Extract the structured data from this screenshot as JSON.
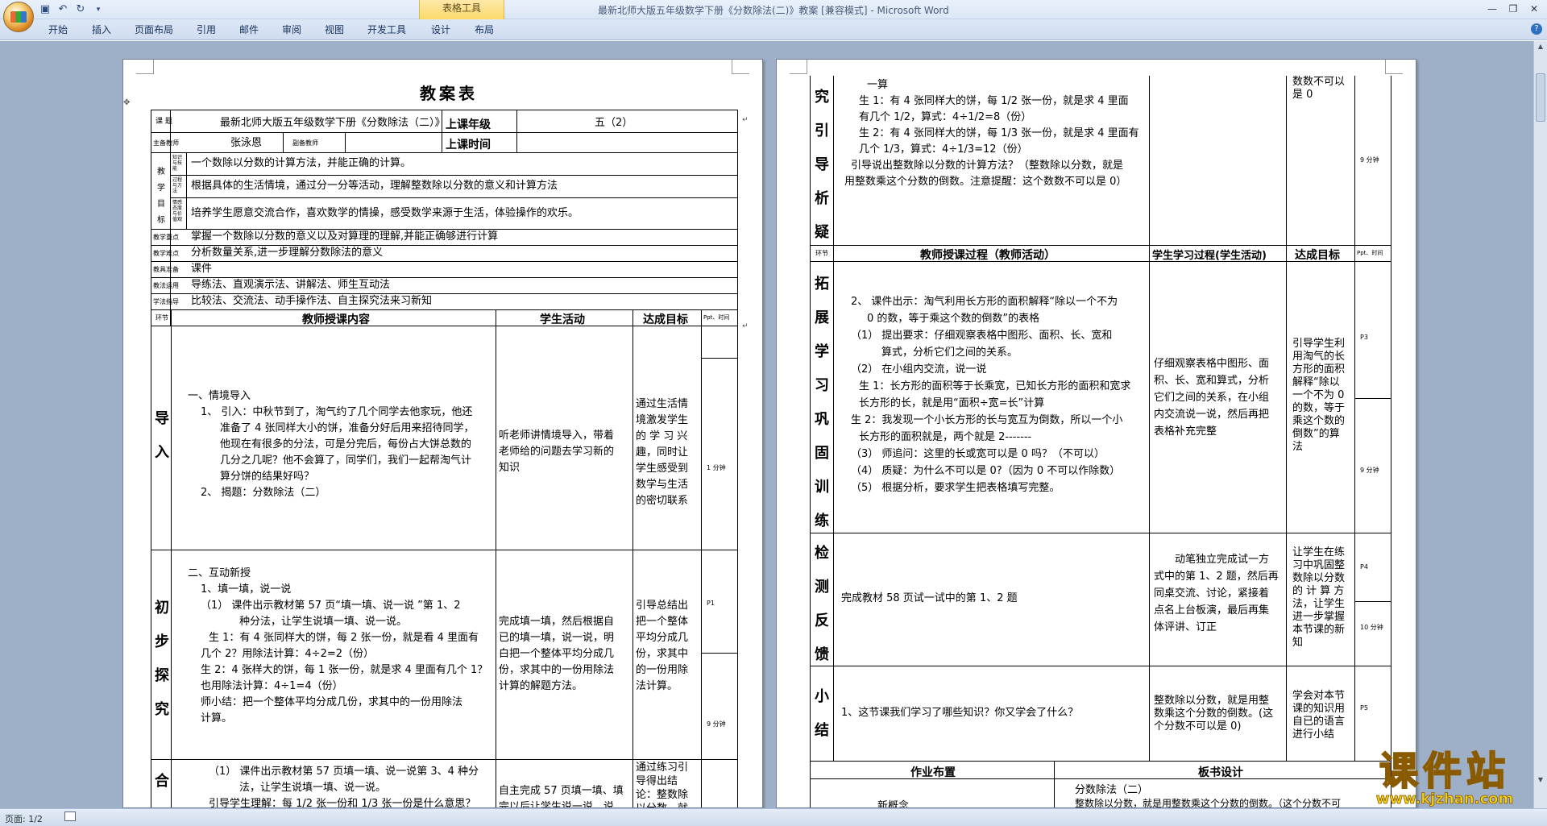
{
  "app": {
    "window_title": "最新北师大版五年级数学下册《分数除法(二)》教案 [兼容模式] - Microsoft Word",
    "context_tab_group": "表格工具",
    "tabs": [
      "开始",
      "插入",
      "页面布局",
      "引用",
      "邮件",
      "审阅",
      "视图",
      "开发工具",
      "设计",
      "布局"
    ],
    "status_page": "页面: 1/2",
    "icons": {
      "save": "save-icon",
      "undo": "undo-icon",
      "redo": "redo-icon",
      "help": "help-icon"
    }
  },
  "page1": {
    "title": "教案表",
    "row_topic": {
      "label": "课 题",
      "value": "最新北师大版五年级数学下册《分数除法（二）》",
      "grade_label": "上课年级",
      "grade_value": "五（2）"
    },
    "row_teacher": {
      "main_label": "主备教师",
      "main_value": "张泳恩",
      "assist_label": "副备教师",
      "time_label": "上课时间"
    },
    "goals": {
      "label": [
        "教",
        "学",
        "目",
        "标"
      ],
      "sub": [
        "知识与技能",
        "过程与方法",
        "情感态度与价值观"
      ],
      "items": [
        "一个数除以分数的计算方法，并能正确的计算。",
        "根据具体的生活情境，通过分一分等活动，理解整数除以分数的意义和计算方法",
        "培养学生愿意交流合作，喜欢数学的情操，感受数学来源于生活，体验操作的欢乐。"
      ]
    },
    "rows": [
      {
        "label": "教学重点",
        "value": "掌握一个数除以分数的意义以及对算理的理解,并能正确够进行计算"
      },
      {
        "label": "教学难点",
        "value": "分析数量关系,进一步理解分数除法的意义"
      },
      {
        "label": "教具准备",
        "value": "课件"
      },
      {
        "label": "教法运用",
        "value": "导练法、直观演示法、讲解法、师生互动法"
      },
      {
        "label": "学法指导",
        "value": "比较法、交流法、动手操作法、自主探究法来习新知"
      }
    ],
    "header": {
      "col0": "环节",
      "col1": "教师授课内容",
      "col2": "学生活动",
      "col3": "达成目标",
      "col4": "Ppt、时间"
    },
    "section_intro": {
      "name": [
        "导",
        "入"
      ],
      "content": [
        "一、情境导入",
        "1、 引入：中秋节到了，淘气约了几个同学去他家玩，他还",
        "准备了 4 张同样大小的饼，准备分好后用来招待同学，",
        "他现在有很多的分法，可是分完后，每份占大饼总数的",
        "几分之几呢？他不会算了，同学们，我们一起帮淘气计",
        "算分饼的结果好吗？",
        "2、 揭题：分数除法（二）"
      ],
      "student": [
        "听老师讲情境导入，带着",
        "老师给的问题去学习新的",
        "知识"
      ],
      "goal": [
        "通过生活情",
        "境激发学生",
        "的 学 习 兴",
        "趣，同时让",
        "学生感受到",
        "数学与生活",
        "的密切联系"
      ],
      "time": "1 分钟"
    },
    "section_explore": {
      "name": [
        "初",
        "步",
        "探",
        "究"
      ],
      "content": [
        "二、互动新授",
        "1、填一填，说一说",
        "（1）    课件出示教材第 57 页“填一填、说一说 ”第 1、2",
        "种分法，让学生说填一填、说一说。",
        "生 1：有 4 张同样大的饼，每 2 张一份，就是看 4 里面有",
        "几个 2？用除法计算：4÷2=2（份）",
        "生 2：4 张样大的饼，每 1 张一份，就是求 4 里面有几个 1？",
        "也用除法计算：4÷1=4（份）",
        "师小结：把一个整体平均分成几份，求其中的一份用除法",
        "计算。"
      ],
      "student": [
        "完成填一填，然后根据自",
        "已的填一填，说一说，明",
        "白把一个整体平均分成几",
        "份，求其中的一份用除法",
        "计算的解题方法。"
      ],
      "goal": [
        "引导总结出",
        "把一个整体",
        "平均分成几",
        "份，求其中",
        "的一份用除",
        "法计算。"
      ],
      "ppt": "P1",
      "time": "9 分钟"
    },
    "section_combine": {
      "name": [
        "合"
      ],
      "content": [
        "（1）    课件出示教材第 57 页填一填、说一说第 3、4 种分",
        "法，让学生说填一填、说一说。",
        "引导学生理解：每 1/2 张一份和 1/3 张一份是什么意思？"
      ],
      "student": [
        "自主完成 57 页填一填、填",
        "完以后让学生说一说，说"
      ],
      "goal": [
        "通过练习引",
        "导得出结",
        "论：整数除",
        "以分数，就"
      ]
    }
  },
  "page2": {
    "section_research": {
      "name": [
        "究",
        "引",
        "导",
        "析",
        "疑"
      ],
      "content": [
        "一算",
        "生 1：有 4 张同样大的饼，每 1/2 张一份，就是求 4 里面",
        "有几个 1/2，算式：4÷1/2=8（份）",
        "生 2：有 4 张同样大的饼，每 1/3 张一份，就是求 4 里面有",
        "几个 1/3，算式：4÷1/3=12（份）",
        "引导说出整数除以分数的计算方法？（整数除以分数，就是",
        "用整数乘这个分数的倒数。注意提醒：这个数数不可以是 0）"
      ],
      "goal": [
        "数数不可以",
        "是 0"
      ],
      "time": "9 分钟"
    },
    "header": {
      "col0": "环节",
      "col1": "教师授课过程（教师活动）",
      "col2": "学生学习过程(学生活动)",
      "col3": "达成目标",
      "col4": "Ppt、时间"
    },
    "section_expand": {
      "name": [
        "拓",
        "展",
        "学",
        "习",
        "巩",
        "固",
        "训",
        "练"
      ],
      "content": [
        "2、 课件出示：淘气利用长方形的面积解释“除以一个不为",
        "0 的数，等于乘这个数的倒数”的表格",
        "（1）    提出要求：仔细观察表格中图形、面积、长、宽和",
        "算式，分析它们之间的关系。",
        "（2）    在小组内交流，说一说",
        "生 1：长方形的面积等于长乘宽，已知长方形的面积和宽求",
        "长方形的长，就是用“面积÷宽=长”计算",
        "生 2：我发现一个小长方形的长与宽互为倒数，所以一个小",
        "长方形的面积就是，两个就是 2-------",
        "（3）    师追问：这里的长或宽可以是 0 吗？（不可以）",
        "（4）    质疑：为什么不可以是 0?（因为 0 不可以作除数）",
        "（5）    根据分析，要求学生把表格填写完整。"
      ],
      "student": [
        "仔细观察表格中图形、面",
        "积、长、宽和算式，分析",
        "它们之间的关系，在小组",
        "内交流说一说，然后再把",
        "表格补充完整"
      ],
      "goal": [
        "引导学生利",
        "用淘气的长",
        "方形的面积",
        "解释“除以",
        "一个不为 0",
        "的数，等于",
        "乘这个数的",
        "倒数”的算",
        "法"
      ],
      "ppt": "P3",
      "time": "9 分钟"
    },
    "section_check": {
      "name": [
        "检",
        "测",
        "反",
        "馈"
      ],
      "content": "完成教材 58 页试一试中的第 1、2 题",
      "student": [
        "动笔独立完成试一方",
        "式中的第 1、2 题，然后再",
        "同桌交流、讨论，紧接着",
        "点名上台板演，最后再集",
        "体评讲、订正"
      ],
      "goal": [
        "让学生在练",
        "习中巩固整",
        "数除以分数",
        "的 计 算 方",
        "法，让学生",
        "进一步掌握",
        "本节课的新",
        "知"
      ],
      "ppt": "P4",
      "time": "10 分钟"
    },
    "section_summary": {
      "name": [
        "小",
        "结"
      ],
      "content": "1、这节课我们学习了哪些知识？你又学会了什么？",
      "student": [
        "整数除以分数，就是用整",
        "数乘这个分数的倒数。(这",
        "个分数不可以是 0)"
      ],
      "goal": [
        "学会对本节",
        "课的知识用",
        "自已的语言",
        "进行小结"
      ],
      "ppt": "P5"
    },
    "homework": {
      "label": "作业布置",
      "board_label": "板书设计",
      "new": "新概念",
      "board_title": "分数除法（二）",
      "board_line": "整数除以分数，就是用整数乘这个分数的倒数。（这个分数不可"
    }
  },
  "watermark": {
    "text": "课件站",
    "url": "www.kjzhan.com",
    "colors": {
      "main": "#f3d21a",
      "outline": "#8a5a00"
    }
  },
  "colors": {
    "workspace": "#9eb0c8",
    "ribbon": "#cfdcef",
    "title_text": "#4a5a78"
  }
}
